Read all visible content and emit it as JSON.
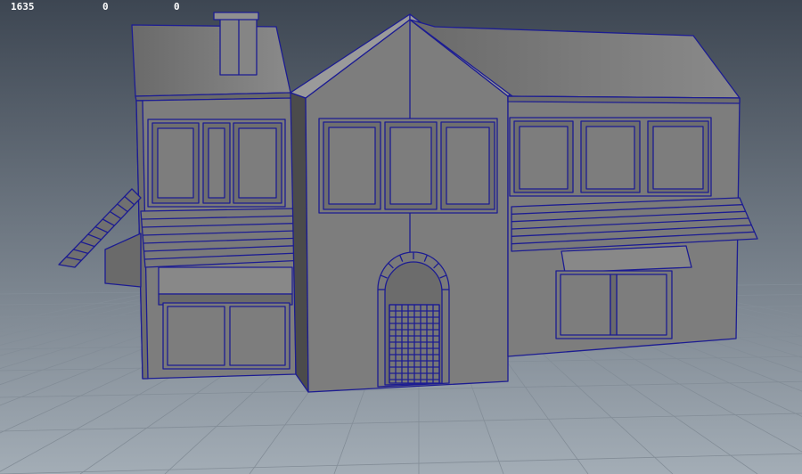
{
  "hud": {
    "values": [
      "1635",
      "0",
      "0"
    ]
  },
  "viewport": {
    "background_top": "#3d4652",
    "background_bottom": "#a3adb6",
    "grid_color": "#838d97",
    "mesh_fill": "#7d7d7d",
    "mesh_fill_dark": "#5e5e5e",
    "mesh_fill_side": "#6e6e6e",
    "wireframe_color": "#1c1c92",
    "object": "building-model"
  }
}
